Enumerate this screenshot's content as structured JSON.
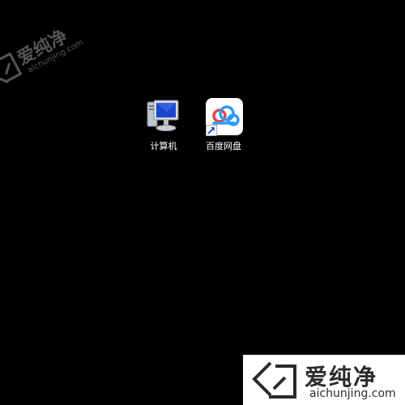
{
  "desktop": {
    "background_color": "#000000",
    "icons": [
      {
        "label": "计算机",
        "icon": "computer-icon"
      },
      {
        "label": "百度网盘",
        "icon": "baidu-netdisk-icon",
        "shortcut": true
      }
    ]
  },
  "watermarks": {
    "top_left": {
      "title": "爱纯净",
      "subtitle": "aichunjing.com"
    },
    "bottom_right": {
      "title": "爱纯净",
      "subtitle": "aichunjing.com",
      "background_color": "#ffffff"
    }
  }
}
